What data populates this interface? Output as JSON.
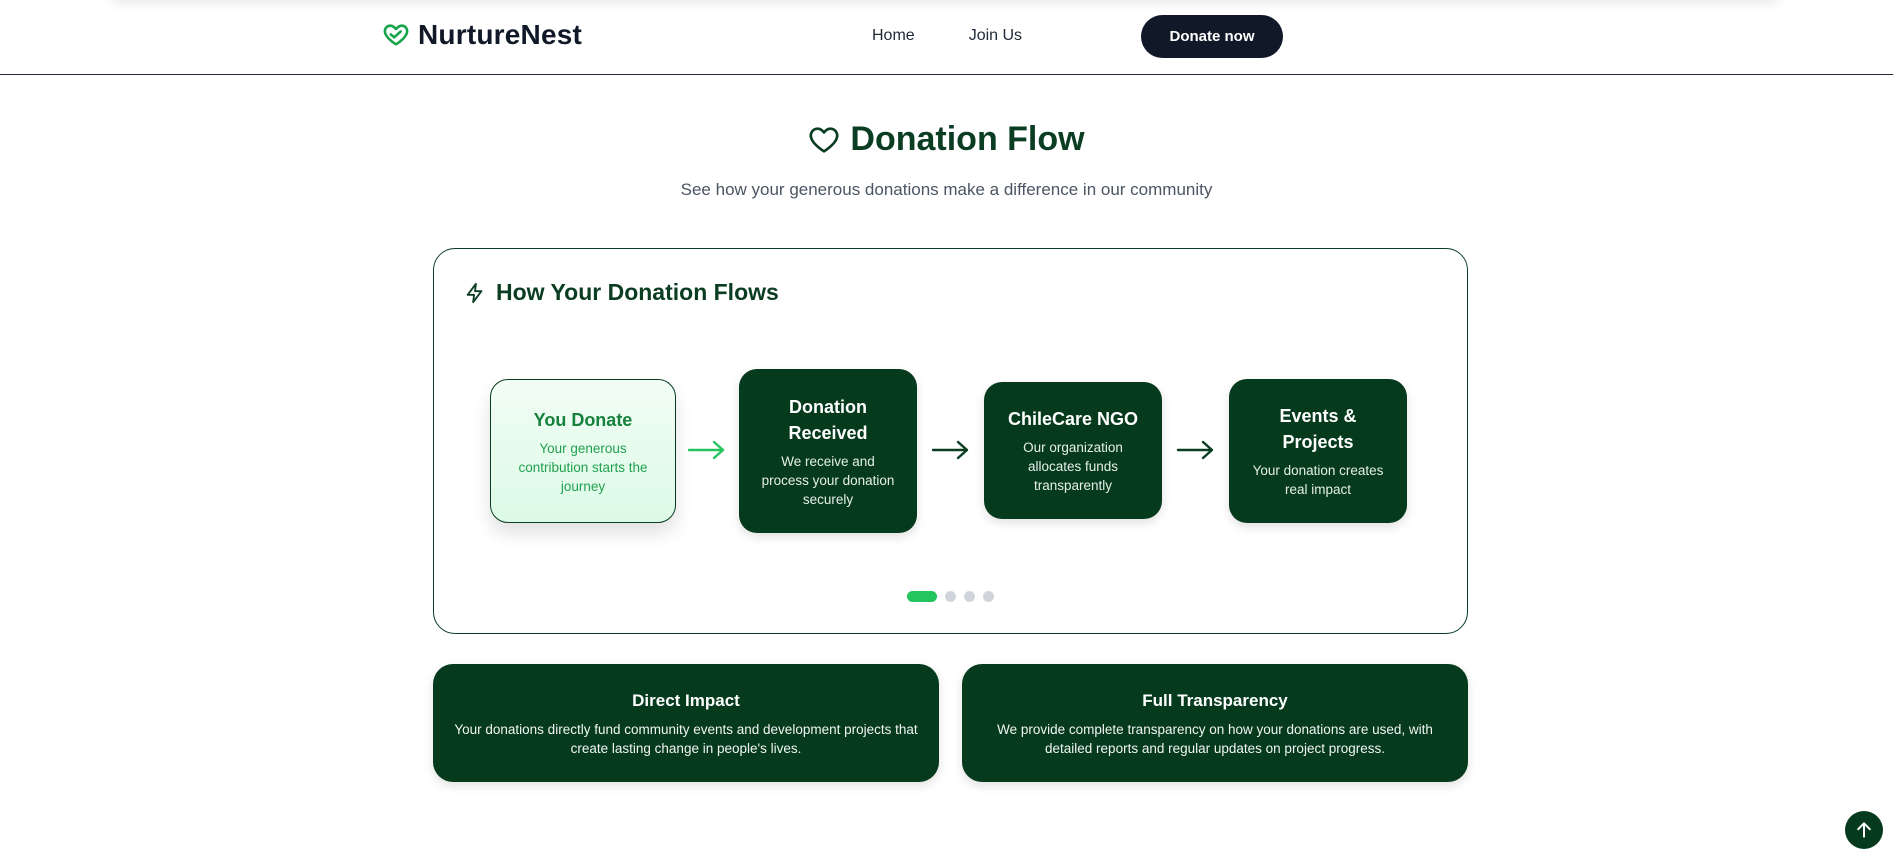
{
  "header": {
    "brand": "NurtureNest",
    "nav": [
      {
        "label": "Home"
      },
      {
        "label": "Join Us"
      }
    ],
    "donate_label": "Donate now"
  },
  "hero": {
    "title": "Donation Flow",
    "subtitle": "See how your generous donations make a difference in our community"
  },
  "flow": {
    "heading": "How Your Donation Flows",
    "steps": [
      {
        "title": "You Donate",
        "desc": "Your generous contribution starts the journey",
        "active": true
      },
      {
        "title": "Donation Received",
        "desc": "We receive and process your donation securely",
        "active": false
      },
      {
        "title": "ChileCare NGO",
        "desc": "Our organization allocates funds transparently",
        "active": false
      },
      {
        "title": "Events & Projects",
        "desc": "Your donation creates real impact",
        "active": false
      }
    ],
    "active_step": 1,
    "step_count": 4
  },
  "info_cards": [
    {
      "title": "Direct Impact",
      "text": "Your donations directly fund community events and development projects that create lasting change in people's lives."
    },
    {
      "title": "Full Transparency",
      "text": "We provide complete transparency on how your donations are used, with detailed reports and regular updates on project progress."
    }
  ],
  "colors": {
    "brand_dark_green": "#063a1d",
    "accent_green": "#22c55e",
    "navy_button": "#111827"
  },
  "icons": {
    "brand": "heart-logo-icon",
    "title": "heart-icon",
    "flow_heading": "lightning-icon",
    "scroll_top": "arrow-up-icon"
  }
}
